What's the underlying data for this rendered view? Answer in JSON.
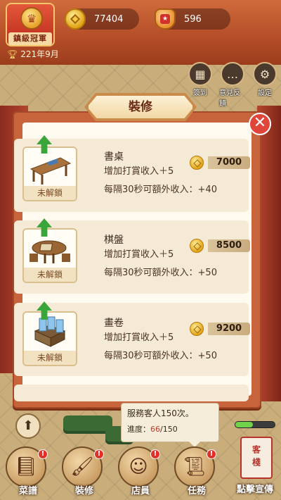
{
  "header": {
    "title_badge": "鎮級冠軍",
    "date": "221年9月",
    "coins": "77404",
    "reputation": "596"
  },
  "side_buttons": [
    {
      "label": "簽到",
      "icon": "calendar-icon"
    },
    {
      "label": "意見反饋",
      "icon": "chat-icon"
    },
    {
      "label": "設定",
      "icon": "gear-icon"
    }
  ],
  "modal": {
    "title": "裝修",
    "close": "✕",
    "items": [
      {
        "name": "書桌",
        "bonus": "增加打賞收入＋5",
        "extra": "每隔30秒可額外收入：+40",
        "price": "7000",
        "status": "未解鎖",
        "icon": "desk-icon"
      },
      {
        "name": "棋盤",
        "bonus": "增加打賞收入＋5",
        "extra": "每隔30秒可額外收入：+50",
        "price": "8500",
        "status": "未解鎖",
        "icon": "go-board-icon"
      },
      {
        "name": "畫卷",
        "bonus": "增加打賞收入＋5",
        "extra": "每隔30秒可額外收入：+50",
        "price": "9200",
        "status": "未解鎖",
        "icon": "scroll-icon"
      }
    ]
  },
  "mission": {
    "text": "服務客人150次。",
    "progress_label": "進度：",
    "current": "66",
    "total": "/150"
  },
  "bottom_nav": [
    {
      "label": "菜譜",
      "icon": "recipe-book-icon",
      "badge": "!"
    },
    {
      "label": "裝修",
      "icon": "paint-brush-icon",
      "badge": "!"
    },
    {
      "label": "店員",
      "icon": "staff-icon",
      "badge": "!"
    },
    {
      "label": "任務",
      "icon": "task-scroll-icon",
      "badge": "!"
    }
  ],
  "promo": {
    "flag": "客棧",
    "label": "點擊宣傳"
  }
}
